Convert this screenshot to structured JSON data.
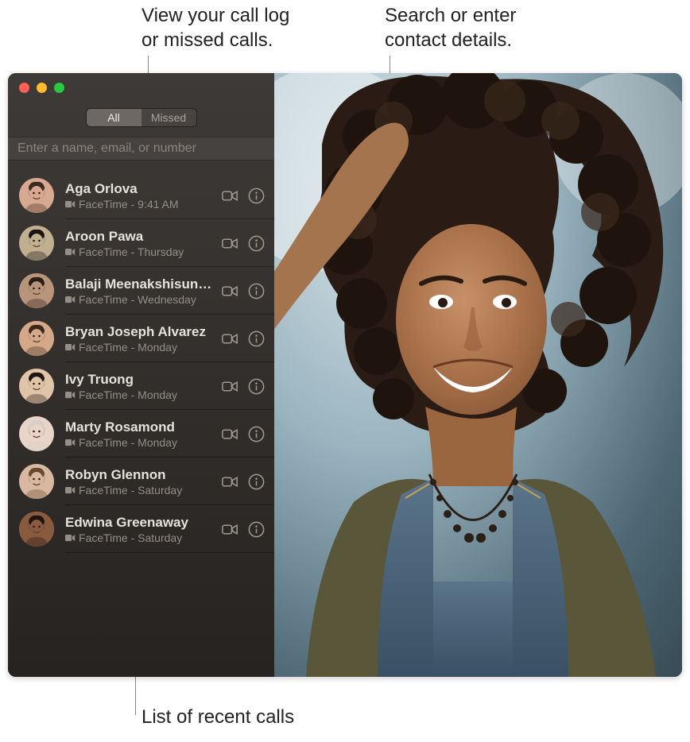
{
  "callouts": {
    "top_left": "View your call log\nor missed calls.",
    "top_right": "Search or enter\ncontact details.",
    "bottom": "List of recent calls"
  },
  "tabs": {
    "all": "All",
    "missed": "Missed",
    "active": "all"
  },
  "search": {
    "placeholder": "Enter a name, email, or number",
    "value": ""
  },
  "calls": [
    {
      "name": "Aga Orlova",
      "type": "FaceTime",
      "time": "9:41 AM",
      "avatar_bg": "#d9a890",
      "avatar_hair": "#3b2a20"
    },
    {
      "name": "Aroon Pawa",
      "type": "FaceTime",
      "time": "Thursday",
      "avatar_bg": "#c0b090",
      "avatar_hair": "#1a1410"
    },
    {
      "name": "Balaji Meenakshisun…",
      "type": "FaceTime",
      "time": "Wednesday",
      "avatar_bg": "#b8947a",
      "avatar_hair": "#2a1e16"
    },
    {
      "name": "Bryan Joseph Alvarez",
      "type": "FaceTime",
      "time": "Monday",
      "avatar_bg": "#d4a888",
      "avatar_hair": "#3a2a1e"
    },
    {
      "name": "Ivy Truong",
      "type": "FaceTime",
      "time": "Monday",
      "avatar_bg": "#e0c4a8",
      "avatar_hair": "#1e1610"
    },
    {
      "name": "Marty Rosamond",
      "type": "FaceTime",
      "time": "Monday",
      "avatar_bg": "#e8d4c8",
      "avatar_hair": "#d8d0c8"
    },
    {
      "name": "Robyn Glennon",
      "type": "FaceTime",
      "time": "Saturday",
      "avatar_bg": "#d8b8a0",
      "avatar_hair": "#6a4a2e"
    },
    {
      "name": "Edwina Greenaway",
      "type": "FaceTime",
      "time": "Saturday",
      "avatar_bg": "#8a5a3e",
      "avatar_hair": "#1e140e"
    }
  ]
}
